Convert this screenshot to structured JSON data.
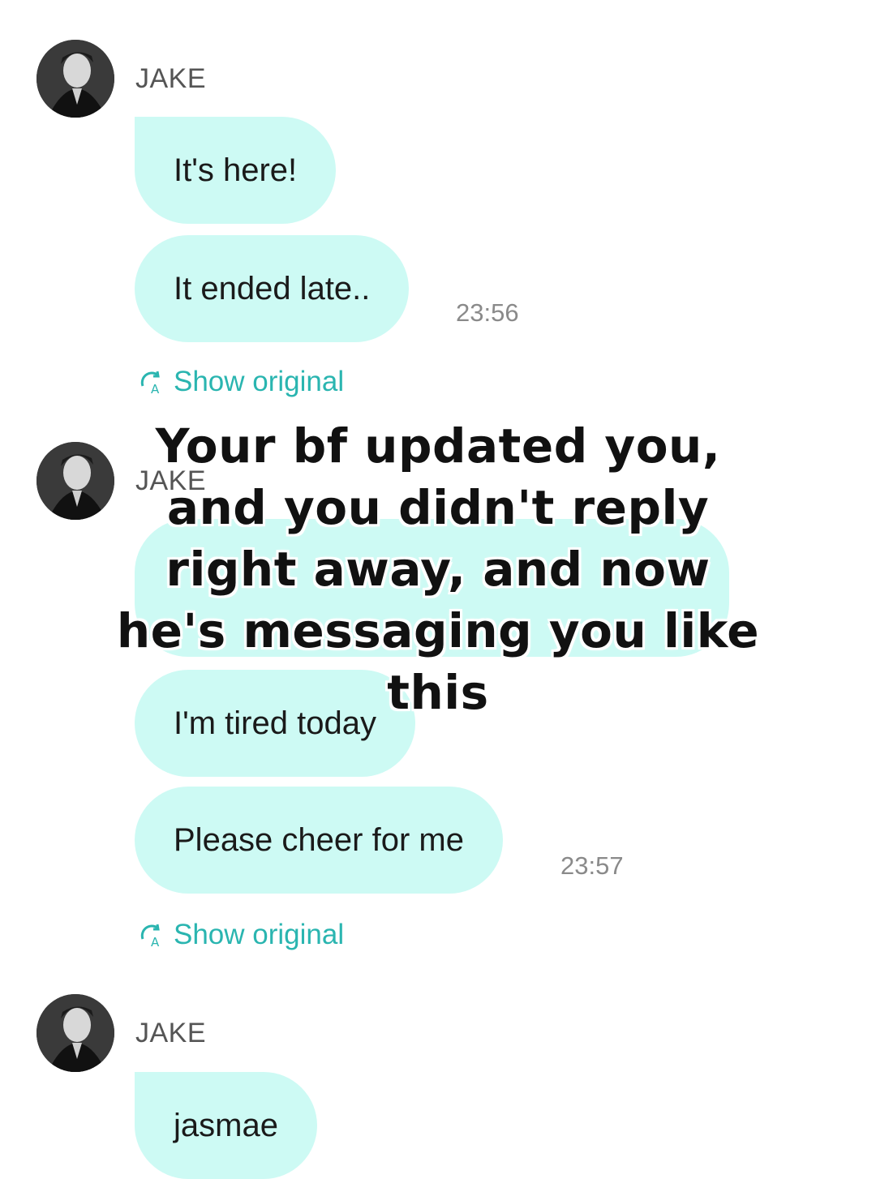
{
  "colors": {
    "bubble": "#cdfaf4",
    "accent": "#2ab5b0"
  },
  "groups": [
    {
      "sender": "JAKE",
      "messages": [
        "It's here!",
        "It ended late.."
      ],
      "time": "23:56",
      "show_original": "Show original"
    },
    {
      "sender": "JAKE",
      "messages": [
        "I'm tired today",
        "Please cheer for me"
      ],
      "time": "23:57",
      "show_original": "Show original"
    },
    {
      "sender": "JAKE",
      "messages": [
        "jasmae"
      ]
    }
  ],
  "overlay_caption": "Your bf updated you, and you didn't reply right away, and now he's messaging you like this",
  "icons": {
    "avatar": "avatar-photo",
    "translate": "translate-icon"
  }
}
